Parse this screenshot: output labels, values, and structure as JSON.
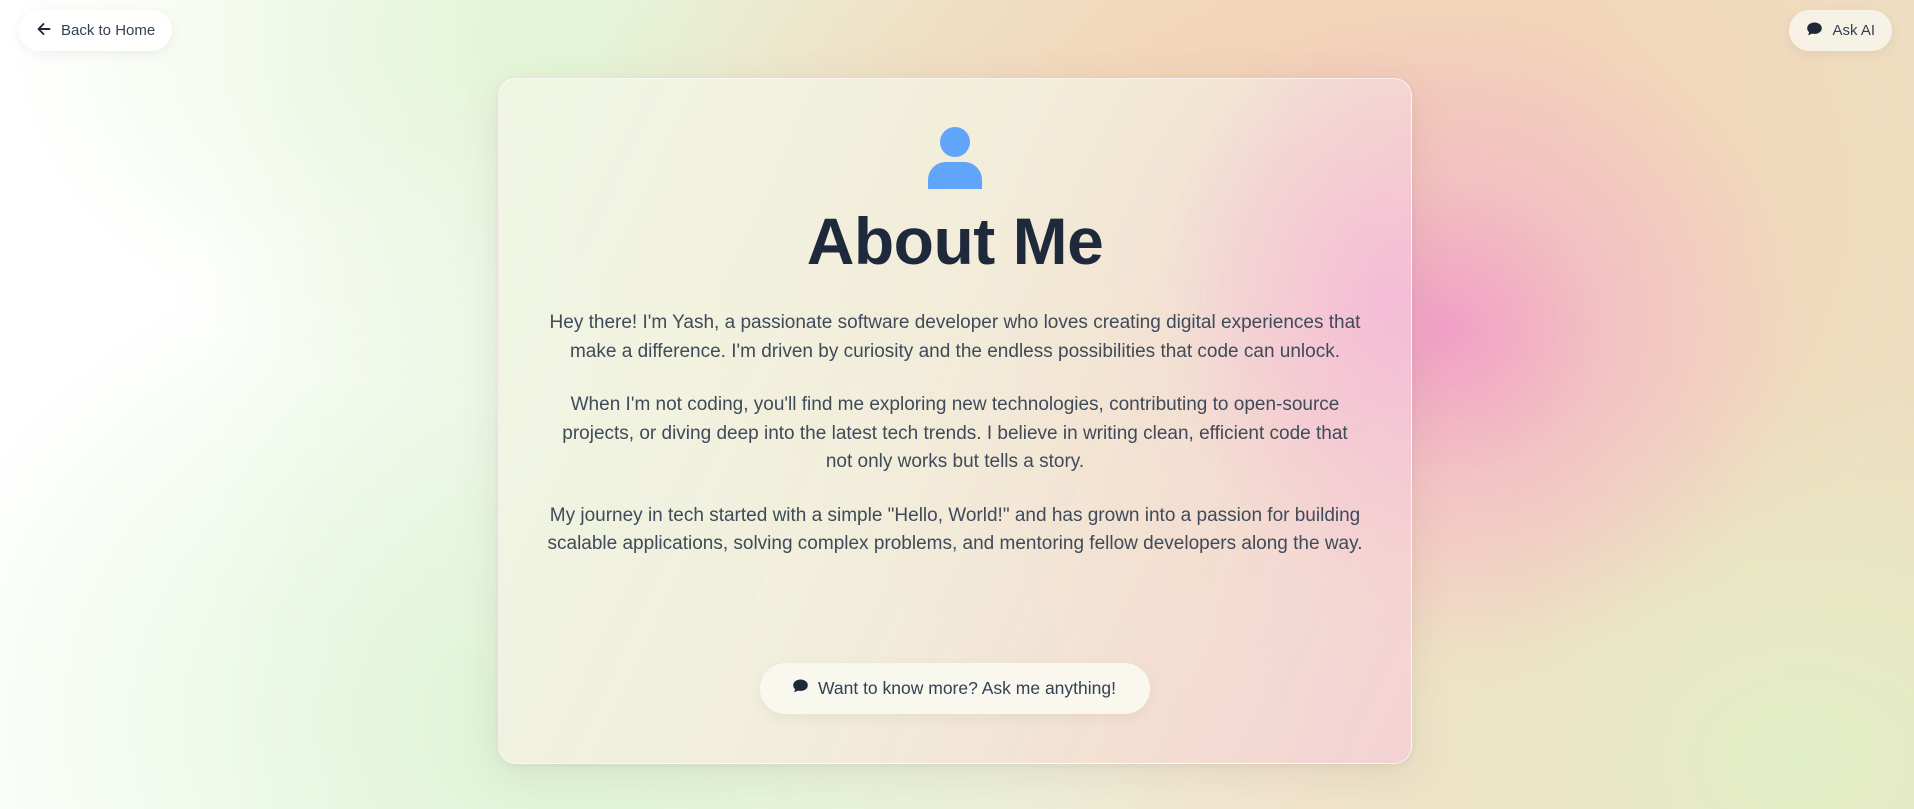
{
  "nav": {
    "back_label": "Back to Home",
    "back_icon": "arrow-left-icon",
    "ask_label": "Ask AI",
    "ask_icon": "chat-bubble-icon"
  },
  "about": {
    "icon": "user-icon",
    "title": "About Me",
    "paragraphs": [
      "Hey there! I'm Yash, a passionate software developer who loves creating digital experiences that make a difference. I'm driven by curiosity and the endless possibilities that code can unlock.",
      "When I'm not coding, you'll find me exploring new technologies, contributing to open-source projects, or diving deep into the latest tech trends. I believe in writing clean, efficient code that not only works but tells a story.",
      "My journey in tech started with a simple \"Hello, World!\" and has grown into a passion for building scalable applications, solving complex problems, and mentoring fellow developers along the way."
    ],
    "cta_label": "Want to know more? Ask me anything!",
    "cta_icon": "chat-bubble-icon"
  },
  "colors": {
    "accent_blue": "#60a5fa",
    "heading": "#1e293b",
    "body_text": "#3f4a5a"
  }
}
